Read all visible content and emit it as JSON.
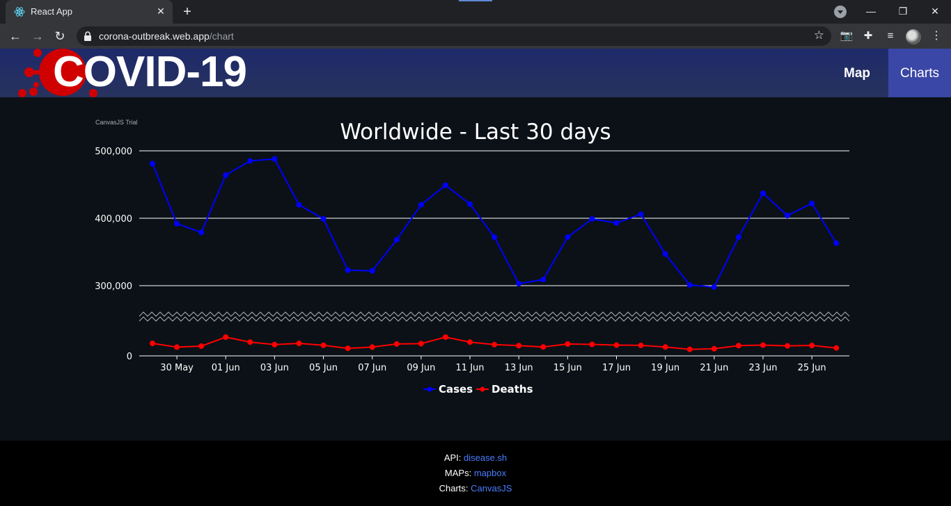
{
  "browser": {
    "tab_title": "React App",
    "url_host": "corona-outbreak.web.app",
    "url_path": "/chart"
  },
  "header": {
    "logo_text": "COVID-19",
    "nav": [
      {
        "label": "Map",
        "active": false
      },
      {
        "label": "Charts",
        "active": true
      }
    ]
  },
  "chart": {
    "trial_label": "CanvasJS Trial"
  },
  "chart_data": {
    "type": "line",
    "title": "Worldwide - Last 30 days",
    "x": [
      "29 May",
      "30 May",
      "31 May",
      "01 Jun",
      "02 Jun",
      "03 Jun",
      "04 Jun",
      "05 Jun",
      "06 Jun",
      "07 Jun",
      "08 Jun",
      "09 Jun",
      "10 Jun",
      "11 Jun",
      "12 Jun",
      "13 Jun",
      "14 Jun",
      "15 Jun",
      "16 Jun",
      "17 Jun",
      "18 Jun",
      "19 Jun",
      "20 Jun",
      "21 Jun",
      "22 Jun",
      "23 Jun",
      "24 Jun",
      "25 Jun",
      "26 Jun"
    ],
    "x_tick_labels": [
      "30 May",
      "01 Jun",
      "03 Jun",
      "05 Jun",
      "07 Jun",
      "09 Jun",
      "11 Jun",
      "13 Jun",
      "15 Jun",
      "17 Jun",
      "19 Jun",
      "21 Jun",
      "23 Jun",
      "25 Jun"
    ],
    "y_tick_labels": [
      "0",
      "300,000",
      "400,000",
      "500,000"
    ],
    "y_scale_break": [
      0,
      0
    ],
    "grid": true,
    "legend_position": "bottom",
    "series": [
      {
        "name": "Cases",
        "color": "#0000ff",
        "values": [
          481000,
          392000,
          379000,
          464000,
          485000,
          488000,
          420000,
          399000,
          323000,
          322000,
          368000,
          420000,
          449000,
          421000,
          372000,
          303000,
          309000,
          372000,
          399000,
          393000,
          406000,
          347000,
          301000,
          298000,
          372000,
          437000,
          404000,
          422000,
          363000
        ]
      },
      {
        "name": "Deaths",
        "color": "#ff0000",
        "values": [
          10000,
          7000,
          7800,
          15000,
          11000,
          9000,
          10000,
          8500,
          6000,
          7000,
          9500,
          9800,
          15000,
          11000,
          9000,
          8200,
          7100,
          9500,
          9200,
          8600,
          8400,
          7100,
          5200,
          5700,
          8200,
          8600,
          8000,
          8300,
          6300
        ]
      }
    ]
  },
  "footer": {
    "api_label": "API:",
    "api_link": "disease.sh",
    "maps_label": "MAPs:",
    "maps_link": "mapbox",
    "charts_label": "Charts:",
    "charts_link": "CanvasJS"
  }
}
